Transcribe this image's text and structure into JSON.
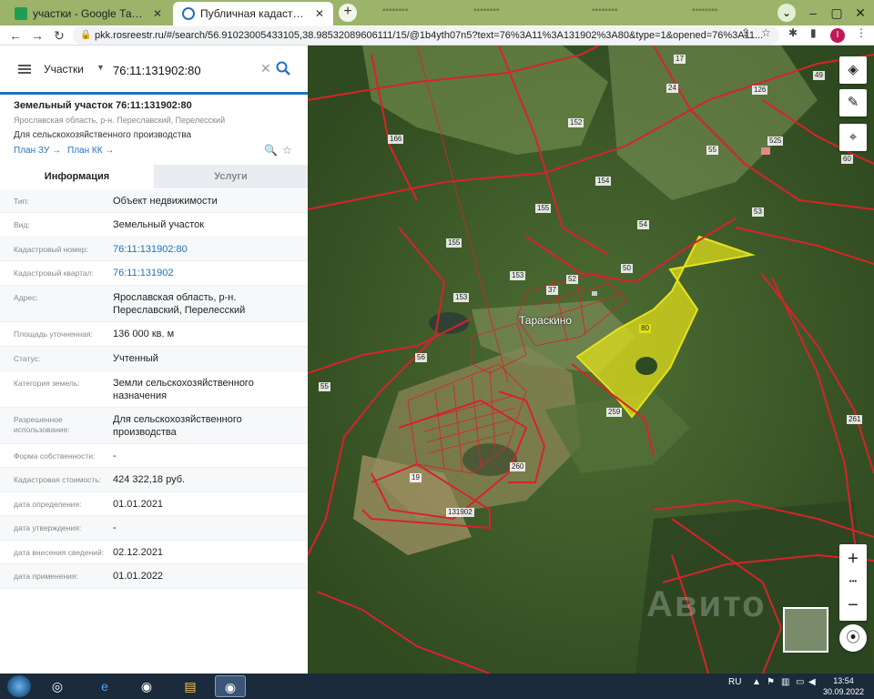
{
  "browser": {
    "tabs": [
      {
        "label": "участки - Google Таблицы",
        "icon": "sheets-icon"
      },
      {
        "label": "Публичная кадастровая карта",
        "icon": "rosreestr-icon"
      }
    ],
    "url": "pkk.rosreestr.ru/#/search/56.91023005433105,38.98532089606111/15/@1b4yth07n5?text=76%3A11%3A131902%3A80&type=1&opened=76%3A11..."
  },
  "search": {
    "type_label": "Участки",
    "query": "76:11:131902:80"
  },
  "object": {
    "title": "Земельный участок 76:11:131902:80",
    "address_short": "Ярославская область, р-н. Переславский, Перелесский",
    "usage": "Для сельскохозяйственного производства",
    "plan_zu": "План ЗУ →",
    "plan_kk": "План КК →"
  },
  "tabs": {
    "info": "Информация",
    "services": "Услуги"
  },
  "properties": [
    {
      "key": "Тип:",
      "value": "Объект недвижимости"
    },
    {
      "key": "Вид:",
      "value": "Земельный участок"
    },
    {
      "key": "Кадастровый номер:",
      "value": "76:11:131902:80"
    },
    {
      "key": "Кадастровый квартал:",
      "value": "76:11:131902"
    },
    {
      "key": "Адрес:",
      "value": "Ярославская область, р-н. Переславский, Перелесский"
    },
    {
      "key": "Площадь уточненная:",
      "value": "136 000 кв. м"
    },
    {
      "key": "Статус:",
      "value": "Учтенный"
    },
    {
      "key": "Категория земель:",
      "value": "Земли сельскохозяйственного назначения"
    },
    {
      "key": "Разрешенное использование:",
      "value": "Для сельскохозяйственного производства"
    },
    {
      "key": "Форма собственности:",
      "value": "-"
    },
    {
      "key": "Кадастровая стоимость:",
      "value": "424 322,18 руб."
    },
    {
      "key": "дата определения:",
      "value": "01.01.2021"
    },
    {
      "key": "дата утверждения:",
      "value": "-"
    },
    {
      "key": "дата внесения сведений:",
      "value": "02.12.2021"
    },
    {
      "key": "дата применения:",
      "value": "01.01.2022"
    }
  ],
  "map": {
    "village": "Тараскино",
    "parcel_labels": [
      "17",
      "49",
      "24",
      "126",
      "166",
      "152",
      "55",
      "525",
      "60",
      "154",
      "155",
      "53",
      "54",
      "155",
      "50",
      "153",
      "37",
      "52",
      "153",
      "80",
      "56",
      "55",
      "259",
      "261",
      "19",
      "260",
      "131902"
    ],
    "highlight_color": "#e6e21a",
    "boundary_color": "#d8232a",
    "zoom_in": "+",
    "zoom_more": "•••",
    "zoom_out": "−",
    "watermark": "Авито"
  },
  "taskbar": {
    "language": "RU",
    "time": "13:54",
    "date": "30.09.2022"
  }
}
